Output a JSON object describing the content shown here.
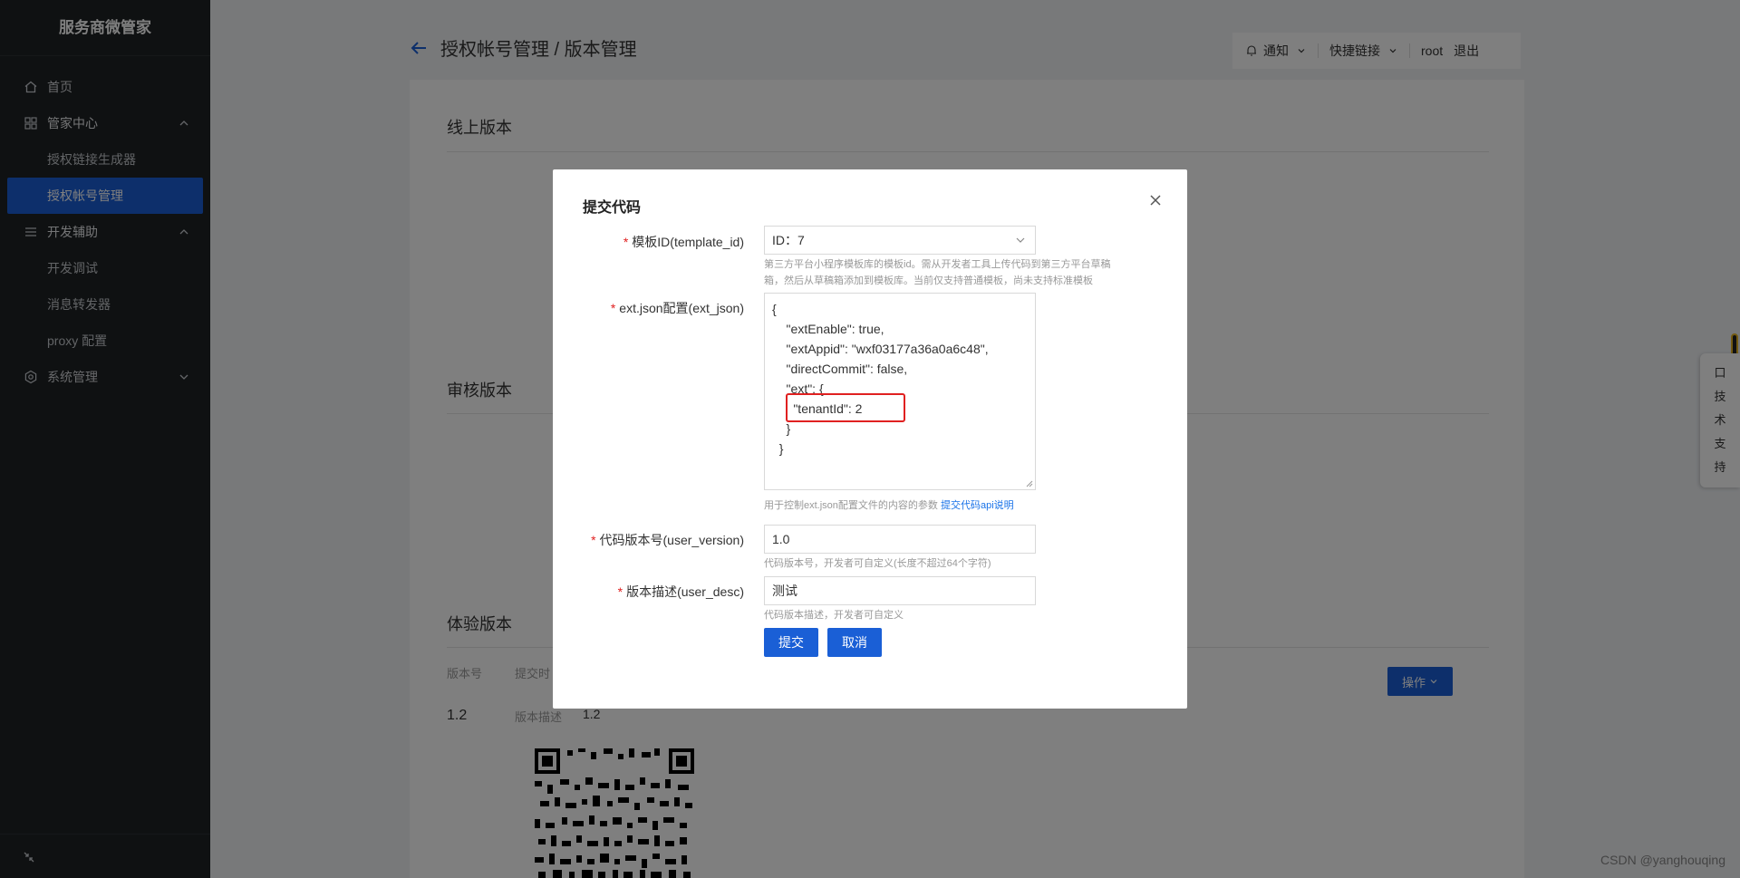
{
  "sidebar": {
    "brand": "服务商微管家",
    "items": [
      {
        "label": "首页",
        "icon": "home-icon"
      },
      {
        "label": "管家中心",
        "icon": "grid-icon"
      },
      {
        "label": "授权链接生成器"
      },
      {
        "label": "授权帐号管理"
      },
      {
        "label": "开发辅助",
        "icon": "list-icon"
      },
      {
        "label": "开发调试"
      },
      {
        "label": "消息转发器"
      },
      {
        "label": "proxy 配置"
      },
      {
        "label": "系统管理",
        "icon": "settings-icon"
      }
    ],
    "active_item": "授权帐号管理"
  },
  "header": {
    "title": "授权帐号管理 / 版本管理",
    "notify_label": "通知",
    "quicklinks_label": "快捷链接",
    "user": "root",
    "logout_label": "退出"
  },
  "page": {
    "online_title": "线上版本",
    "review_title": "审核版本",
    "experience_title": "体验版本",
    "version_label": "版本号",
    "submit_time_label": "提交时",
    "version_value": "1.2",
    "desc_label": "版本描述",
    "desc_value": "1.2",
    "operate_label": "操作"
  },
  "support": {
    "chars": [
      "口",
      "技",
      "术",
      "支",
      "持"
    ]
  },
  "watermark": "CSDN @yanghouqing",
  "dialog": {
    "title": "提交代码",
    "template_label": "模板ID(template_id)",
    "template_value": "ID：7",
    "template_hint_1": "第三方平台小程序模板库的模板id。需从开发者工具上传代码到第三方平台草稿",
    "template_hint_2": "箱，然后从草稿箱添加到模板库。当前仅支持普通模板，尚未支持标准模板",
    "ext_label": "ext.json配置(ext_json)",
    "ext_lines": [
      "{",
      "    \"extEnable\": true,",
      "    \"extAppid\": \"wxf03177a36a0a6c48\",",
      "    \"directCommit\": false,",
      "    \"ext\": {",
      "      \"tenantId\": 2",
      "    }",
      "  }"
    ],
    "ext_hint": "用于控制ext.json配置文件的内容的参数",
    "ext_hint_link": "提交代码api说明",
    "version_label": "代码版本号(user_version)",
    "version_value": "1.0",
    "version_hint": "代码版本号，开发者可自定义(长度不超过64个字符)",
    "desc_label": "版本描述(user_desc)",
    "desc_value": "测试",
    "desc_hint": "代码版本描述，开发者可自定义",
    "submit_label": "提交",
    "cancel_label": "取消"
  }
}
